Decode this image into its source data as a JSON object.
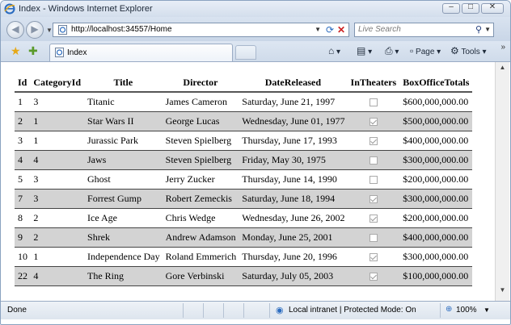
{
  "window": {
    "title": "Index - Windows Internet Explorer",
    "minimize_glyph": "–",
    "maximize_glyph": "□",
    "close_glyph": "✕"
  },
  "address_bar": {
    "url": "http://localhost:34557/Home"
  },
  "search": {
    "placeholder": "Live Search"
  },
  "tab": {
    "label": "Index"
  },
  "command_bar": {
    "page_label": "Page",
    "tools_label": "Tools"
  },
  "table": {
    "headers": [
      "Id",
      "CategoryId",
      "Title",
      "Director",
      "DateReleased",
      "InTheaters",
      "BoxOfficeTotals"
    ],
    "rows": [
      {
        "id": "1",
        "category_id": "3",
        "title": "Titanic",
        "director": "James Cameron",
        "date_released": "Saturday, June 21, 1997",
        "in_theaters": false,
        "box_office": "$600,000,000.00"
      },
      {
        "id": "2",
        "category_id": "1",
        "title": "Star Wars II",
        "director": "George Lucas",
        "date_released": "Wednesday, June 01, 1977",
        "in_theaters": true,
        "box_office": "$500,000,000.00"
      },
      {
        "id": "3",
        "category_id": "1",
        "title": "Jurassic Park",
        "director": "Steven Spielberg",
        "date_released": "Thursday, June 17, 1993",
        "in_theaters": true,
        "box_office": "$400,000,000.00"
      },
      {
        "id": "4",
        "category_id": "4",
        "title": "Jaws",
        "director": "Steven Spielberg",
        "date_released": "Friday, May 30, 1975",
        "in_theaters": false,
        "box_office": "$300,000,000.00"
      },
      {
        "id": "5",
        "category_id": "3",
        "title": "Ghost",
        "director": "Jerry Zucker",
        "date_released": "Thursday, June 14, 1990",
        "in_theaters": false,
        "box_office": "$200,000,000.00"
      },
      {
        "id": "7",
        "category_id": "3",
        "title": "Forrest Gump",
        "director": "Robert Zemeckis",
        "date_released": "Saturday, June 18, 1994",
        "in_theaters": true,
        "box_office": "$300,000,000.00"
      },
      {
        "id": "8",
        "category_id": "2",
        "title": "Ice Age",
        "director": "Chris Wedge",
        "date_released": "Wednesday, June 26, 2002",
        "in_theaters": true,
        "box_office": "$200,000,000.00"
      },
      {
        "id": "9",
        "category_id": "2",
        "title": "Shrek",
        "director": "Andrew Adamson",
        "date_released": "Monday, June 25, 2001",
        "in_theaters": false,
        "box_office": "$400,000,000.00"
      },
      {
        "id": "10",
        "category_id": "1",
        "title": "Independence Day",
        "director": "Roland Emmerich",
        "date_released": "Thursday, June 20, 1996",
        "in_theaters": true,
        "box_office": "$300,000,000.00"
      },
      {
        "id": "22",
        "category_id": "4",
        "title": "The Ring",
        "director": "Gore Verbinski",
        "date_released": "Saturday, July 05, 2003",
        "in_theaters": true,
        "box_office": "$100,000,000.00"
      }
    ]
  },
  "status_bar": {
    "status": "Done",
    "zone": "Local intranet | Protected Mode: On",
    "zoom": "100%"
  },
  "icons": {
    "back": "back-arrow-icon",
    "forward": "forward-arrow-icon",
    "favorites": "favorites-star-icon",
    "add_favorites": "add-favorites-icon",
    "home": "home-icon",
    "feeds": "feeds-icon",
    "print": "print-icon",
    "refresh": "refresh-icon",
    "stop": "stop-icon",
    "search": "search-icon"
  },
  "colors": {
    "alt_row": "#d3d3d3",
    "chrome": "#d3deec",
    "ie_blue": "#2a6bbf"
  }
}
